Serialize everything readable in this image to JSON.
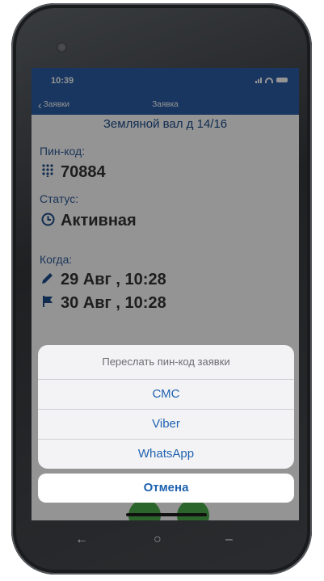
{
  "status_bar": {
    "time": "10:39"
  },
  "nav": {
    "back_label": "Заявки",
    "title": "Заявка"
  },
  "request": {
    "address": "Земляной вал д 14/16",
    "pin_label": "Пин-код:",
    "pin_value": "70884",
    "status_label": "Статус:",
    "status_value": "Активная",
    "when_label": "Когда:",
    "created": "29 Авг , 10:28",
    "deadline": "30 Авг , 10:28"
  },
  "action_sheet": {
    "title": "Переслать пин-код заявки",
    "options": [
      "СМС",
      "Viber",
      "WhatsApp"
    ],
    "cancel": "Отмена"
  },
  "system_nav": {
    "back_glyph": "←",
    "home_glyph": "○",
    "recent_glyph": "–"
  },
  "colors": {
    "nav_bar": "#2a5ea6",
    "accent": "#1e62b0",
    "fab": "#4cae4c"
  },
  "icons": [
    "keypad-icon",
    "clock-icon",
    "pencil-icon",
    "flag-icon",
    "chevron-left-icon"
  ]
}
